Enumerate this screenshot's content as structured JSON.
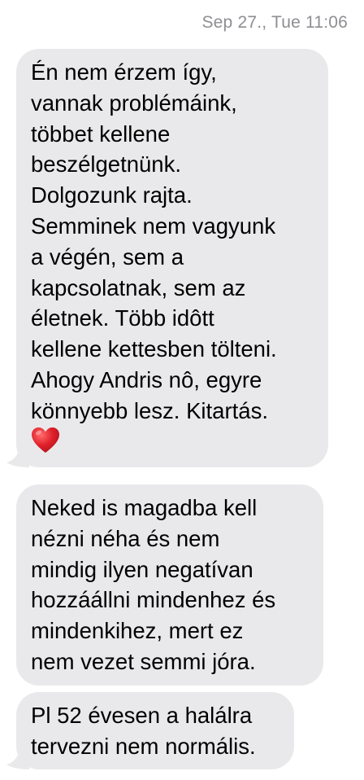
{
  "header": {
    "timestamp": "Sep 27., Tue 11:06"
  },
  "messages": [
    {
      "lines": [
        "Én nem érzem így,",
        "vannak problémáink,",
        "többet kellene",
        "beszélgetnünk.",
        "Dolgozunk rajta.",
        "Semminek nem vagyunk",
        "a végén, sem a",
        "kapcsolatnak, sem az",
        "életnek. Több idôtt",
        "kellene kettesben tölteni.",
        "Ahogy Andris nô, egyre",
        "könnyebb lesz. Kitartás."
      ],
      "emoji": "red-heart-emoji"
    },
    {
      "lines": [
        "Neked is magadba kell",
        "nézni néha és nem",
        "mindig ilyen negatívan",
        "hozzáállni mindenhez és",
        "mindenkihez, mert ez",
        "nem vezet semmi jóra."
      ]
    },
    {
      "lines": [
        "Pl 52 évesen a halálra",
        "tervezni nem normális."
      ]
    }
  ],
  "colors": {
    "bubble_received": "#e9e9eb",
    "timestamp_text": "#8e8e93",
    "heart": "#e0202a"
  }
}
